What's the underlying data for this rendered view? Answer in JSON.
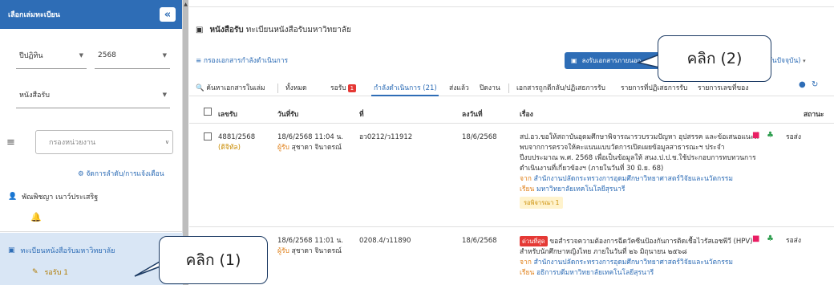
{
  "sidebar": {
    "header": "เลือกเล่มทะเบียน",
    "collapse_glyph": "«",
    "year_type": "ปีปฏิทิน",
    "year": "2568",
    "book_type": "หนังสือรับ",
    "unit_placeholder": "กรองหน่วยงาน",
    "manage_link": "จัดการลำดับ/การแจ้งเตือน",
    "user": "พัณพิชญา เนาว์ประเสริฐ",
    "registry": "ทะเบียนหนังสือรับมหาวิทยาลัย",
    "pending": "รอรับ 1"
  },
  "header": {
    "title_bold": "หนังสือรับ",
    "title_rest": "ทะเบียนหนังสือรับมหาวิทยาลัย",
    "filter_link": "กรองเอกสารกำลังดำเนินการ",
    "register_button": "ลงรับเอกสารภายนอก",
    "date_dropdown": "วันปัจจุบัน)"
  },
  "tabs": {
    "search": "ค้นหาเอกสารในเล่ม",
    "all": "ทั้งหมด",
    "pending": "รอรับ",
    "pending_count": "1",
    "in_progress": "กำลังดำเนินการ (21)",
    "sent": "ส่งแล้ว",
    "closed": "ปิดงาน",
    "returned": "เอกสารถูกตีกลับ/ปฏิเสธการรับ",
    "refused_list": "รายการที่ปฏิเสธการรับ",
    "cancelled_list": "รายการเลขที่ของ"
  },
  "table": {
    "headers": {
      "number": "เลขรับ",
      "date": "วันที่รับ",
      "doc_no": "ที่",
      "doc_date": "ลงวันที่",
      "subject": "เรื่อง",
      "status": "สถานะ"
    },
    "rows": [
      {
        "number": "4881/2568",
        "number_note": "(ดิจิทัล)",
        "date": "18/6/2568 11:04 น.",
        "receiver_label": "ผู้รับ",
        "receiver": "สุชาดา จินาดรณ์",
        "doc_no": "อว0212/ว11912",
        "doc_date": "18/6/2568",
        "subject": "สป.อว.ขอให้สถาบันอุดมศึกษาพิจารณารวบรวมปัญหา อุปสรรค และข้อเสนอแนะที่พบจากการตรวจให้คะแนนแบบวัดการเปิดเผยข้อมูลสาธารณะฯ ประจำปีงบประมาณ พ.ศ. 2568 เพื่อเป็นข้อมูลให้ สนง.ป.ป.ช.ใช้ประกอบการทบทวนการดำเนินงานที่เกี่ยวข้องฯ (ภายในวันที่ 30 มิ.ย. 68)",
        "from_label": "จาก",
        "from": "สำนักงานปลัดกระทรวงการอุดมศึกษาวิทยาศาสตร์วิจัยและนวัตกรรม",
        "to_label": "เรียน",
        "to": "มหาวิทยาลัยเทคโนโลยีสุรนารี",
        "tag": "รอพิจารณา 1",
        "status": "รอส่ง"
      },
      {
        "number": "",
        "date": "18/6/2568 11:01 น.",
        "receiver_label": "ผู้รับ",
        "receiver": "สุชาดา จินาดรณ์",
        "doc_no": "0208.4/ว11890",
        "doc_date": "18/6/2568",
        "urgent": "ด่วนที่สุด",
        "subject": "ขอสำรวจความต้องการฉีดวัคซีนป้องกันการติดเชื้อไวรัสเอชพีวี (HPV) สำหรับนักศึกษาหญิงไทย ภายในวันที่ ๒๖ มิถุนายน ๒๕๖๘",
        "from_label": "จาก",
        "from": "สำนักงานปลัดกระทรวงการอุดมศึกษาวิทยาศาสตร์วิจัยและนวัตกรรม",
        "to_label": "เรียน",
        "to": "อธิการบดีมหาวิทยาลัยเทคโนโลยีสุรนารี",
        "status": "รอส่ง"
      }
    ]
  },
  "callouts": {
    "one": "คลิก (1)",
    "two": "คลิก (2)"
  },
  "colors": {
    "primary": "#2e6db6",
    "sidebar_header": "#2e6db6",
    "selected_bg": "#d9e6f5",
    "danger": "#e53935"
  }
}
